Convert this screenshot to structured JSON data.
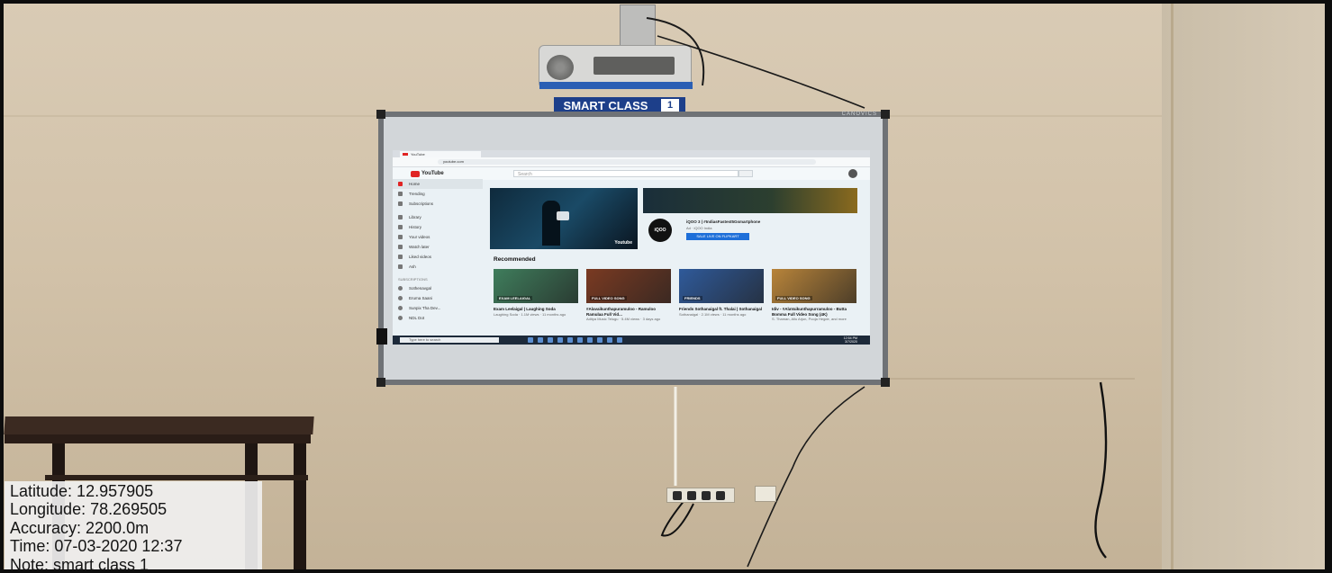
{
  "projector_sign": {
    "text": "SMART CLASS",
    "number": "1"
  },
  "board_brand": "CANOVICS",
  "screen": {
    "tab_title": "YouTube",
    "url": "youtube.com",
    "search_placeholder": "Search",
    "logo": "YouTube",
    "sidebar": [
      {
        "label": "Home",
        "active": true
      },
      {
        "label": "Trending"
      },
      {
        "label": "Subscriptions"
      },
      {
        "label": "Library"
      },
      {
        "label": "History"
      },
      {
        "label": "Your videos"
      },
      {
        "label": "Watch later"
      },
      {
        "label": "Liked videos"
      },
      {
        "label": "Ash"
      }
    ],
    "subscriptions_heading": "SUBSCRIPTIONS",
    "subscriptions": [
      "Sothenavgal",
      "Eruma Saani",
      "Sunpix Tha Dev...",
      "NDL Dot"
    ],
    "banner_logo": "Youtube",
    "ad": {
      "logo": "iQOO",
      "title": "iQOO 3 | #IndiasFastest5Gsmartphone",
      "sub": "Ad · iQOO India",
      "button": "SALE LIVE ON FLIPKART"
    },
    "recommended_title": "Recommended",
    "cards": [
      {
        "thumb": "EXAM LEELAIGAL",
        "title": "Exam Leelaigal | Laughing Soda",
        "meta": "Laughing Soda · 1.1M views · 11 months ago",
        "color": "#3f7d5c"
      },
      {
        "thumb": "FULL VIDEO SONG",
        "title": "#Alavaikunthapuramuloo - Ramuloo Ramulaa Full Vid...",
        "meta": "Aditya Music Telugu · 5.4M views · 3 days ago",
        "color": "#7a3a22"
      },
      {
        "thumb": "FRIENDS",
        "title": "Friends Sothanaigal ft. Thalai | Sothanaigal",
        "meta": "Sothanaigal · 2.1M views · 11 months ago",
        "color": "#2f5a9a"
      },
      {
        "thumb": "FULL VIDEO SONG",
        "title": "Idiv - #AlaVaikunthapurramuloo - Butta Bomma Full Video Song (4K)",
        "meta": "S. Thaman, Allu Arjun, Pooja Hegde, and more",
        "color": "#b8843a"
      }
    ],
    "taskbar_search": "Type here to search",
    "clock": "12:54 PM",
    "date": "3/7/2020"
  },
  "overlay": {
    "latitude": "Latitude: 12.957905",
    "longitude": "Longitude: 78.269505",
    "accuracy": "Accuracy: 2200.0m",
    "time": "Time: 07-03-2020 12:37",
    "note": "Note: smart class 1"
  }
}
